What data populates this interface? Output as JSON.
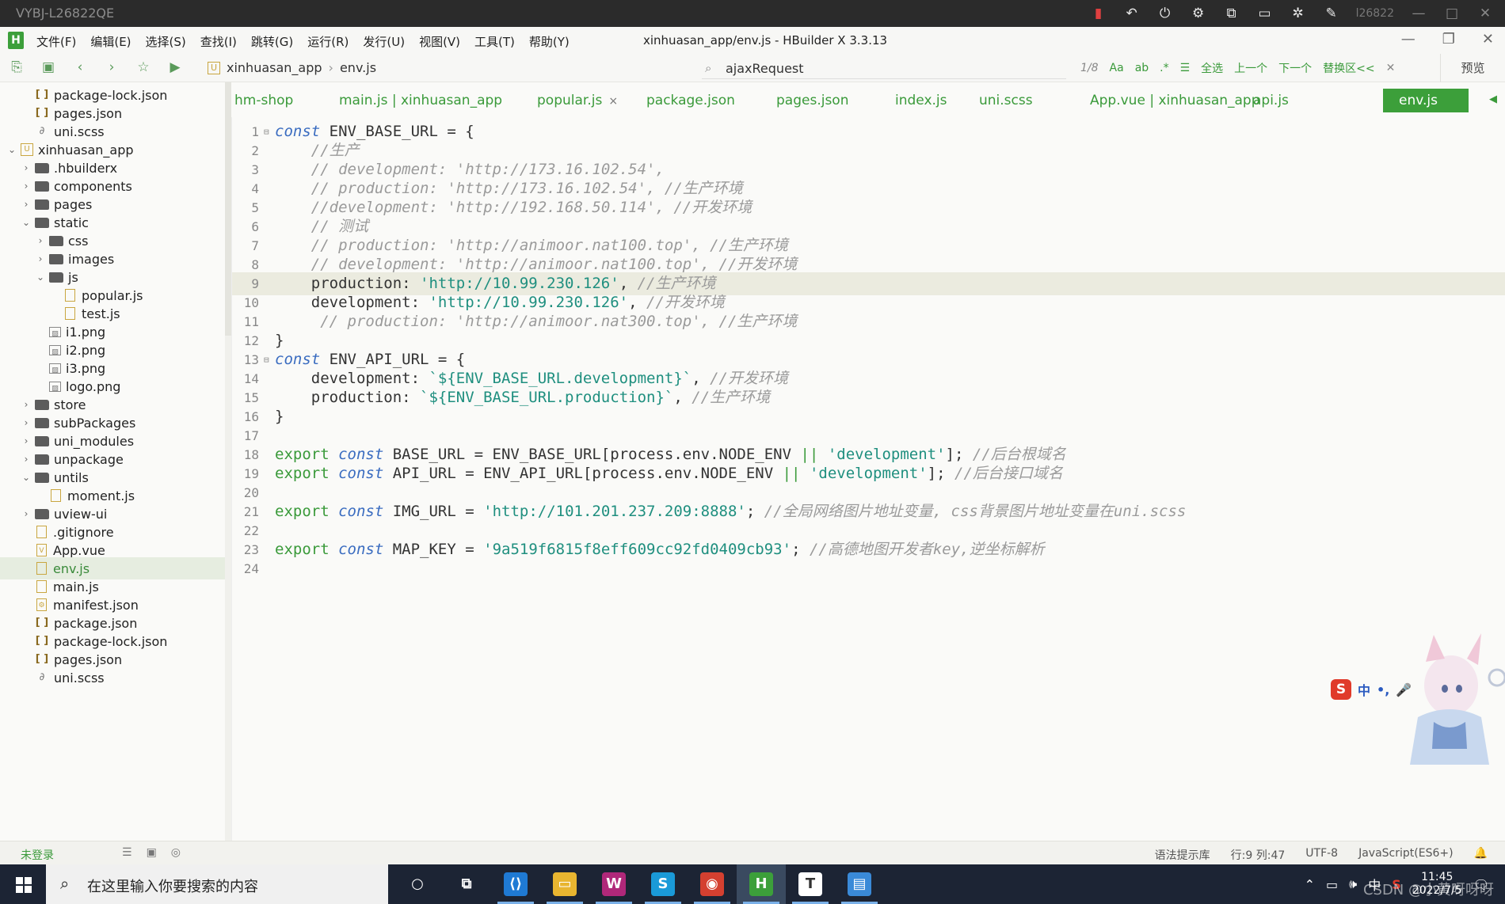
{
  "remote": {
    "title": "VYBJ-L26822QE",
    "id_label": "l26822",
    "icons": [
      "signal-icon",
      "undo-icon",
      "power-icon",
      "settings-alt-icon",
      "share-icon",
      "window-icon",
      "gear-icon",
      "tools-icon"
    ]
  },
  "app": {
    "logo_letter": "H",
    "window_title": "xinhuasan_app/env.js - HBuilder X 3.3.13",
    "menus": [
      "文件(F)",
      "编辑(E)",
      "选择(S)",
      "查找(I)",
      "跳转(G)",
      "运行(R)",
      "发行(U)",
      "视图(V)",
      "工具(T)",
      "帮助(Y)"
    ]
  },
  "toolbar": {
    "breadcrumb": [
      "xinhuasan_app",
      "env.js"
    ],
    "search_value": "ajaxRequest",
    "match_count": "1/8",
    "find_options": [
      "Aa",
      "ab",
      ".*"
    ],
    "select_all": "全选",
    "prev": "上一个",
    "next": "下一个",
    "replace": "替换区<<",
    "preview": "预览"
  },
  "sidebar": {
    "items": [
      {
        "label": "package-lock.json",
        "type": "json",
        "depth": 1,
        "arrow": ""
      },
      {
        "label": "pages.json",
        "type": "json",
        "depth": 1,
        "arrow": ""
      },
      {
        "label": "uni.scss",
        "type": "scss",
        "depth": 1,
        "arrow": ""
      },
      {
        "label": "xinhuasan_app",
        "type": "project",
        "depth": 0,
        "arrow": "⌄"
      },
      {
        "label": ".hbuilderx",
        "type": "folder",
        "depth": 1,
        "arrow": "›"
      },
      {
        "label": "components",
        "type": "folder",
        "depth": 1,
        "arrow": "›"
      },
      {
        "label": "pages",
        "type": "folder",
        "depth": 1,
        "arrow": "›"
      },
      {
        "label": "static",
        "type": "folder",
        "depth": 1,
        "arrow": "⌄"
      },
      {
        "label": "css",
        "type": "folder",
        "depth": 2,
        "arrow": "›"
      },
      {
        "label": "images",
        "type": "folder",
        "depth": 2,
        "arrow": "›"
      },
      {
        "label": "js",
        "type": "folder",
        "depth": 2,
        "arrow": "⌄"
      },
      {
        "label": "popular.js",
        "type": "file",
        "depth": 3,
        "arrow": ""
      },
      {
        "label": "test.js",
        "type": "file",
        "depth": 3,
        "arrow": ""
      },
      {
        "label": "i1.png",
        "type": "img",
        "depth": 2,
        "arrow": ""
      },
      {
        "label": "i2.png",
        "type": "img",
        "depth": 2,
        "arrow": ""
      },
      {
        "label": "i3.png",
        "type": "img",
        "depth": 2,
        "arrow": ""
      },
      {
        "label": "logo.png",
        "type": "img",
        "depth": 2,
        "arrow": ""
      },
      {
        "label": "store",
        "type": "folder",
        "depth": 1,
        "arrow": "›"
      },
      {
        "label": "subPackages",
        "type": "folder",
        "depth": 1,
        "arrow": "›"
      },
      {
        "label": "uni_modules",
        "type": "folder",
        "depth": 1,
        "arrow": "›"
      },
      {
        "label": "unpackage",
        "type": "folder",
        "depth": 1,
        "arrow": "›"
      },
      {
        "label": "untils",
        "type": "folder",
        "depth": 1,
        "arrow": "⌄"
      },
      {
        "label": "moment.js",
        "type": "file",
        "depth": 2,
        "arrow": ""
      },
      {
        "label": "uview-ui",
        "type": "folder",
        "depth": 1,
        "arrow": "›"
      },
      {
        "label": ".gitignore",
        "type": "file",
        "depth": 1,
        "arrow": ""
      },
      {
        "label": "App.vue",
        "type": "vue",
        "depth": 1,
        "arrow": ""
      },
      {
        "label": "env.js",
        "type": "file",
        "depth": 1,
        "arrow": "",
        "selected": true
      },
      {
        "label": "main.js",
        "type": "file",
        "depth": 1,
        "arrow": ""
      },
      {
        "label": "manifest.json",
        "type": "manifest",
        "depth": 1,
        "arrow": ""
      },
      {
        "label": "package.json",
        "type": "json",
        "depth": 1,
        "arrow": ""
      },
      {
        "label": "package-lock.json",
        "type": "json",
        "depth": 1,
        "arrow": ""
      },
      {
        "label": "pages.json",
        "type": "json",
        "depth": 1,
        "arrow": ""
      },
      {
        "label": "uni.scss",
        "type": "scss",
        "depth": 1,
        "arrow": ""
      }
    ]
  },
  "tabs": [
    {
      "label": "hm-shop"
    },
    {
      "label": "main.js | xinhuasan_app"
    },
    {
      "label": "popular.js",
      "closable": true
    },
    {
      "label": "package.json"
    },
    {
      "label": "pages.json"
    },
    {
      "label": "index.js"
    },
    {
      "label": "uni.scss"
    },
    {
      "label": "App.vue | xinhuasan_app"
    },
    {
      "label": "api.js"
    },
    {
      "label": "env.js",
      "active": true
    }
  ],
  "editor": {
    "lines": [
      {
        "n": "1",
        "fold": "⊟",
        "segs": [
          [
            "kw",
            "const"
          ],
          [
            "",
            "ENV_BASE_URL = {"
          ]
        ]
      },
      {
        "n": "2",
        "segs": [
          [
            "",
            "    "
          ],
          [
            "cm",
            "//生产"
          ]
        ]
      },
      {
        "n": "3",
        "segs": [
          [
            "",
            "    "
          ],
          [
            "cm",
            "// development: 'http://173.16.102.54',"
          ]
        ]
      },
      {
        "n": "4",
        "segs": [
          [
            "",
            "    "
          ],
          [
            "cm",
            "// production: 'http://173.16.102.54', //生产环境"
          ]
        ]
      },
      {
        "n": "5",
        "segs": [
          [
            "",
            "    "
          ],
          [
            "cm",
            "//development: 'http://192.168.50.114', //开发环境"
          ]
        ]
      },
      {
        "n": "6",
        "segs": [
          [
            "",
            "    "
          ],
          [
            "cm",
            "// 测试"
          ]
        ]
      },
      {
        "n": "7",
        "segs": [
          [
            "",
            "    "
          ],
          [
            "cm",
            "// production: 'http://animoor.nat100.top', //生产环境"
          ]
        ]
      },
      {
        "n": "8",
        "segs": [
          [
            "",
            "    "
          ],
          [
            "cm",
            "// development: 'http://animoor.nat100.top', //开发环境"
          ]
        ]
      },
      {
        "n": "9",
        "hl": true,
        "segs": [
          [
            "",
            "    production: "
          ],
          [
            "st",
            "'http://10.99.230.126'"
          ],
          [
            "",
            ", "
          ],
          [
            "cm",
            "//生产环境"
          ]
        ]
      },
      {
        "n": "10",
        "segs": [
          [
            "",
            "    development: "
          ],
          [
            "st",
            "'http://10.99.230.126'"
          ],
          [
            "",
            ", "
          ],
          [
            "cm",
            "//开发环境"
          ]
        ]
      },
      {
        "n": "11",
        "segs": [
          [
            "",
            "     "
          ],
          [
            "cm",
            "// production: 'http://animoor.nat300.top', //生产环境"
          ]
        ]
      },
      {
        "n": "12",
        "segs": [
          [
            "",
            "}"
          ]
        ]
      },
      {
        "n": "13",
        "fold": "⊟",
        "segs": [
          [
            "kw",
            "const"
          ],
          [
            "",
            "ENV_API_URL = {"
          ]
        ]
      },
      {
        "n": "14",
        "segs": [
          [
            "",
            "    development: "
          ],
          [
            "st",
            "`${ENV_BASE_URL.development}`"
          ],
          [
            "",
            ", "
          ],
          [
            "cm",
            "//开发环境"
          ]
        ]
      },
      {
        "n": "15",
        "segs": [
          [
            "",
            "    production: "
          ],
          [
            "st",
            "`${ENV_BASE_URL.production}`"
          ],
          [
            "",
            ", "
          ],
          [
            "cm",
            "//生产环境"
          ]
        ]
      },
      {
        "n": "16",
        "segs": [
          [
            "",
            "}"
          ]
        ]
      },
      {
        "n": "17",
        "segs": []
      },
      {
        "n": "18",
        "segs": [
          [
            "ex",
            "export "
          ],
          [
            "kw",
            "const"
          ],
          [
            "",
            " BASE_URL = ENV_BASE_URL[process.env.NODE_ENV "
          ],
          [
            "ex",
            "||"
          ],
          [
            "",
            " "
          ],
          [
            "st",
            "'development'"
          ],
          [
            "",
            "]; "
          ],
          [
            "cm",
            "//后台根域名"
          ]
        ]
      },
      {
        "n": "19",
        "segs": [
          [
            "ex",
            "export "
          ],
          [
            "kw",
            "const"
          ],
          [
            "",
            " API_URL = ENV_API_URL[process.env.NODE_ENV "
          ],
          [
            "ex",
            "||"
          ],
          [
            "",
            " "
          ],
          [
            "st",
            "'development'"
          ],
          [
            "",
            "]; "
          ],
          [
            "cm",
            "//后台接口域名"
          ]
        ]
      },
      {
        "n": "20",
        "segs": []
      },
      {
        "n": "21",
        "segs": [
          [
            "ex",
            "export "
          ],
          [
            "kw",
            "const"
          ],
          [
            "",
            " IMG_URL = "
          ],
          [
            "st",
            "'http://101.201.237.209:8888'"
          ],
          [
            "",
            "; "
          ],
          [
            "cm",
            "//全局网络图片地址变量, css背景图片地址变量在uni.scss"
          ]
        ]
      },
      {
        "n": "22",
        "segs": []
      },
      {
        "n": "23",
        "segs": [
          [
            "ex",
            "export "
          ],
          [
            "kw",
            "const"
          ],
          [
            "",
            " MAP_KEY = "
          ],
          [
            "st",
            "'9a519f6815f8eff609cc92fd0409cb93'"
          ],
          [
            "",
            "; "
          ],
          [
            "cm",
            "//高德地图开发者key,逆坐标解析"
          ]
        ]
      },
      {
        "n": "24",
        "segs": []
      }
    ]
  },
  "ime": {
    "lang": "中",
    "punct": "•,"
  },
  "statusbar": {
    "login": "未登录",
    "syntax": "语法提示库",
    "position": "行:9  列:47",
    "encoding": "UTF-8",
    "language": "JavaScript(ES6+)"
  },
  "taskbar": {
    "search_placeholder": "在这里输入你要搜索的内容",
    "apps": [
      {
        "name": "cortana",
        "glyph": "○",
        "color": "transparent"
      },
      {
        "name": "task-view",
        "glyph": "⧉",
        "color": "transparent"
      },
      {
        "name": "vscode",
        "glyph": "⟨⟩",
        "color": "#1f7ad4"
      },
      {
        "name": "file-explorer",
        "glyph": "▭",
        "color": "#e8b530"
      },
      {
        "name": "webstorm",
        "glyph": "W",
        "color": "#b0287a"
      },
      {
        "name": "skype",
        "glyph": "S",
        "color": "#1a9ad8"
      },
      {
        "name": "chrome",
        "glyph": "◉",
        "color": "#d44030"
      },
      {
        "name": "hbuilderx",
        "glyph": "H",
        "color": "#3c9f3a"
      },
      {
        "name": "typora",
        "glyph": "T",
        "color": "#ffffff"
      },
      {
        "name": "remote",
        "glyph": "▤",
        "color": "#3a8ad8"
      }
    ],
    "tray_lang": "中",
    "time": "11:45",
    "date": "2022/7/5",
    "watermark": "CSDN @小黄呀呀呀"
  }
}
